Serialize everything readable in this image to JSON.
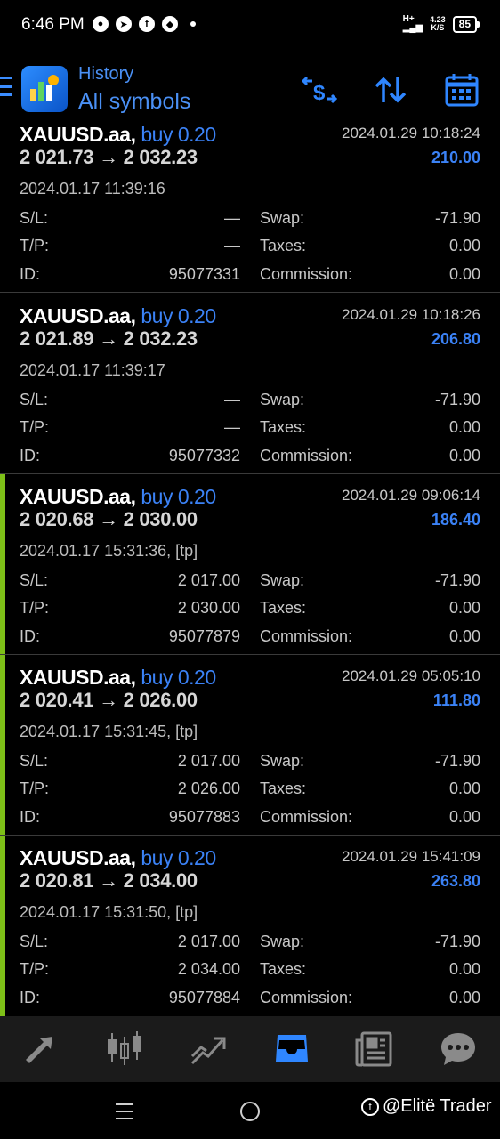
{
  "status_bar": {
    "time": "6:46 PM",
    "network": "H+",
    "speed_value": "4.23",
    "speed_unit": "K/S",
    "battery": "85"
  },
  "header": {
    "subtitle": "History",
    "title": "All symbols",
    "icons": [
      "menu-icon",
      "app-logo",
      "balance-icon",
      "sort-icon",
      "calendar-icon"
    ],
    "accent_color": "#4a90f5"
  },
  "trades": [
    {
      "symbol": "XAUUSD.aa,",
      "side": "buy 0.20",
      "open_price": "2 021.73",
      "close_price": "2 032.23",
      "close_time": "2024.01.29 10:18:24",
      "profit": "210.00",
      "open_time": "2024.01.17 11:39:16",
      "sl_label": "S/L:",
      "sl": "—",
      "tp_label": "T/P:",
      "tp": "—",
      "id_label": "ID:",
      "id": "95077331",
      "swap_label": "Swap:",
      "swap": "-71.90",
      "taxes_label": "Taxes:",
      "taxes": "0.00",
      "commission_label": "Commission:",
      "commission": "0.00"
    },
    {
      "symbol": "XAUUSD.aa,",
      "side": "buy 0.20",
      "open_price": "2 021.89",
      "close_price": "2 032.23",
      "close_time": "2024.01.29 10:18:26",
      "profit": "206.80",
      "open_time": "2024.01.17 11:39:17",
      "sl_label": "S/L:",
      "sl": "—",
      "tp_label": "T/P:",
      "tp": "—",
      "id_label": "ID:",
      "id": "95077332",
      "swap_label": "Swap:",
      "swap": "-71.90",
      "taxes_label": "Taxes:",
      "taxes": "0.00",
      "commission_label": "Commission:",
      "commission": "0.00"
    },
    {
      "symbol": "XAUUSD.aa,",
      "side": "buy 0.20",
      "open_price": "2 020.68",
      "close_price": "2 030.00",
      "close_time": "2024.01.29 09:06:14",
      "profit": "186.40",
      "open_time": "2024.01.17 15:31:36, [tp]",
      "sl_label": "S/L:",
      "sl": "2 017.00",
      "tp_label": "T/P:",
      "tp": "2 030.00",
      "id_label": "ID:",
      "id": "95077879",
      "swap_label": "Swap:",
      "swap": "-71.90",
      "taxes_label": "Taxes:",
      "taxes": "0.00",
      "commission_label": "Commission:",
      "commission": "0.00"
    },
    {
      "symbol": "XAUUSD.aa,",
      "side": "buy 0.20",
      "open_price": "2 020.41",
      "close_price": "2 026.00",
      "close_time": "2024.01.29 05:05:10",
      "profit": "111.80",
      "open_time": "2024.01.17 15:31:45, [tp]",
      "sl_label": "S/L:",
      "sl": "2 017.00",
      "tp_label": "T/P:",
      "tp": "2 026.00",
      "id_label": "ID:",
      "id": "95077883",
      "swap_label": "Swap:",
      "swap": "-71.90",
      "taxes_label": "Taxes:",
      "taxes": "0.00",
      "commission_label": "Commission:",
      "commission": "0.00"
    },
    {
      "symbol": "XAUUSD.aa,",
      "side": "buy 0.20",
      "open_price": "2 020.81",
      "close_price": "2 034.00",
      "close_time": "2024.01.29 15:41:09",
      "profit": "263.80",
      "open_time": "2024.01.17 15:31:50, [tp]",
      "sl_label": "S/L:",
      "sl": "2 017.00",
      "tp_label": "T/P:",
      "tp": "2 034.00",
      "id_label": "ID:",
      "id": "95077884",
      "swap_label": "Swap:",
      "swap": "-71.90",
      "taxes_label": "Taxes:",
      "taxes": "0.00",
      "commission_label": "Commission:",
      "commission": "0.00"
    }
  ],
  "arrow": "→",
  "bottom_nav": [
    "quotes-icon",
    "chart-icon",
    "trade-icon",
    "history-icon",
    "news-icon",
    "messages-icon"
  ],
  "active_nav": "history-icon",
  "watermark": "@Elitë Trader"
}
